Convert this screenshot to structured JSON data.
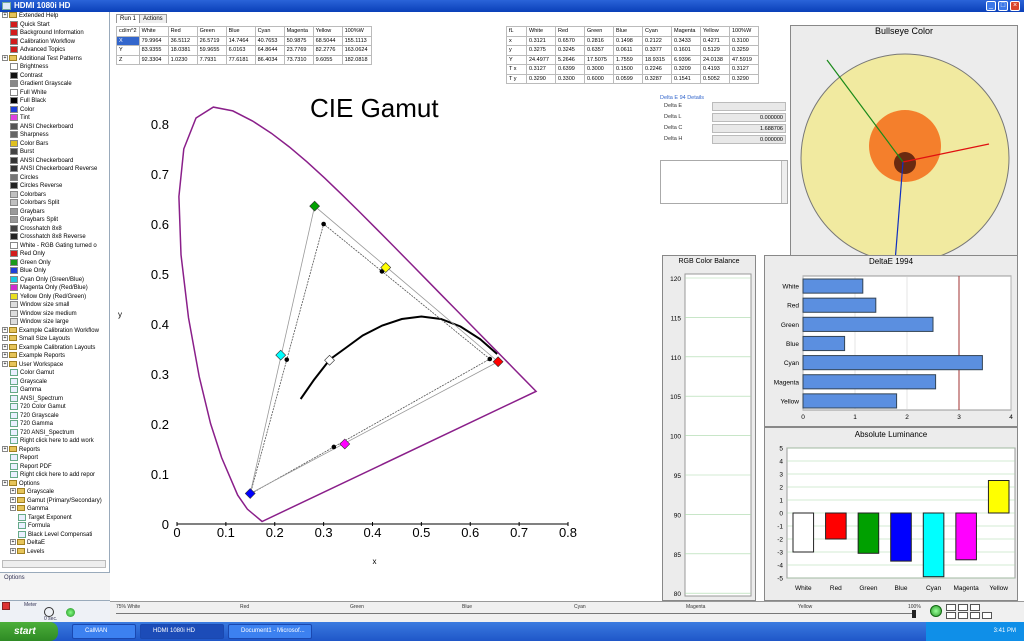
{
  "window": {
    "title": "HDMI 1080i HD",
    "min": "_",
    "max": "□",
    "close": "×"
  },
  "sidebar": {
    "items": [
      {
        "label": "Extended Help",
        "kind": "folder",
        "lvl": 0
      },
      {
        "label": "Quick Start",
        "kind": "swatch",
        "color": "#d21c1c",
        "lvl": 1
      },
      {
        "label": "Background Information",
        "kind": "swatch",
        "color": "#d21c1c",
        "lvl": 1
      },
      {
        "label": "Calibration Workflow",
        "kind": "swatch",
        "color": "#d21c1c",
        "lvl": 1
      },
      {
        "label": "Advanced Topics",
        "kind": "swatch",
        "color": "#d21c1c",
        "lvl": 1
      },
      {
        "label": "Additional Test Patterns",
        "kind": "folder",
        "lvl": 0
      },
      {
        "label": "Brightness",
        "kind": "swatch",
        "color": "#ffffff",
        "lvl": 1
      },
      {
        "label": "Contrast",
        "kind": "swatch",
        "color": "#111111",
        "lvl": 1
      },
      {
        "label": "Gradient Grayscale",
        "kind": "swatch",
        "color": "#888888",
        "lvl": 1
      },
      {
        "label": "Full White",
        "kind": "swatch",
        "color": "#ffffff",
        "lvl": 1
      },
      {
        "label": "Full Black",
        "kind": "swatch",
        "color": "#000000",
        "lvl": 1
      },
      {
        "label": "Color",
        "kind": "swatch",
        "color": "#1e3fd8",
        "lvl": 1
      },
      {
        "label": "Tint",
        "kind": "swatch",
        "color": "#e040e0",
        "lvl": 1
      },
      {
        "label": "ANSI Checkerboard",
        "kind": "swatch",
        "color": "#555555",
        "lvl": 1
      },
      {
        "label": "Sharpness",
        "kind": "swatch",
        "color": "#666666",
        "lvl": 1
      },
      {
        "label": "Color Bars",
        "kind": "swatch",
        "color": "#e0c020",
        "lvl": 1
      },
      {
        "label": "Burst",
        "kind": "swatch",
        "color": "#444444",
        "lvl": 1
      },
      {
        "label": "ANSI Checkerboard",
        "kind": "swatch",
        "color": "#333333",
        "lvl": 1
      },
      {
        "label": "ANSI Checkerboard Reverse",
        "kind": "swatch",
        "color": "#333333",
        "lvl": 1
      },
      {
        "label": "Circles",
        "kind": "swatch",
        "color": "#777777",
        "lvl": 1
      },
      {
        "label": "Circles Reverse",
        "kind": "swatch",
        "color": "#222222",
        "lvl": 1
      },
      {
        "label": "Colorbars",
        "kind": "swatch",
        "color": "#c0c0c0",
        "lvl": 1
      },
      {
        "label": "Colorbars Split",
        "kind": "swatch",
        "color": "#c0c0c0",
        "lvl": 1
      },
      {
        "label": "Graybars",
        "kind": "swatch",
        "color": "#999999",
        "lvl": 1
      },
      {
        "label": "Graybars Split",
        "kind": "swatch",
        "color": "#999999",
        "lvl": 1
      },
      {
        "label": "Crosshatch 8x8",
        "kind": "swatch",
        "color": "#444444",
        "lvl": 1
      },
      {
        "label": "Crosshatch 8x8 Reverse",
        "kind": "swatch",
        "color": "#222222",
        "lvl": 1
      },
      {
        "label": "White - RGB Gating turned o",
        "kind": "swatch",
        "color": "#ffffff",
        "lvl": 1
      },
      {
        "label": "Red Only",
        "kind": "swatch",
        "color": "#d21c1c",
        "lvl": 1
      },
      {
        "label": "Green Only",
        "kind": "swatch",
        "color": "#1a9a1a",
        "lvl": 1
      },
      {
        "label": "Blue Only",
        "kind": "swatch",
        "color": "#1e3fd8",
        "lvl": 1
      },
      {
        "label": "Cyan Only (Green/Blue)",
        "kind": "swatch",
        "color": "#18c8e0",
        "lvl": 1
      },
      {
        "label": "Magenta Only (Red/Blue)",
        "kind": "swatch",
        "color": "#d02ad0",
        "lvl": 1
      },
      {
        "label": "Yellow Only (Red/Green)",
        "kind": "swatch",
        "color": "#e8e020",
        "lvl": 1
      },
      {
        "label": "Window size small",
        "kind": "swatch",
        "color": "#dddddd",
        "lvl": 1
      },
      {
        "label": "Window size medium",
        "kind": "swatch",
        "color": "#dddddd",
        "lvl": 1
      },
      {
        "label": "Window size large",
        "kind": "swatch",
        "color": "#dddddd",
        "lvl": 1
      },
      {
        "label": "Example Calibration Workflow",
        "kind": "folder",
        "lvl": 0
      },
      {
        "label": "Small Size Layouts",
        "kind": "folder",
        "lvl": 0
      },
      {
        "label": "Example Calibration Layouts",
        "kind": "folder",
        "lvl": 0
      },
      {
        "label": "Example Reports",
        "kind": "folder",
        "lvl": 0
      },
      {
        "label": "User Workspace",
        "kind": "folder",
        "lvl": 0
      },
      {
        "label": "Color Gamut",
        "kind": "page",
        "lvl": 1
      },
      {
        "label": "Grayscale",
        "kind": "page",
        "lvl": 1
      },
      {
        "label": "Gamma",
        "kind": "page",
        "lvl": 1
      },
      {
        "label": "ANSI_Spectrum",
        "kind": "page",
        "lvl": 1
      },
      {
        "label": "720 Color Gamut",
        "kind": "page",
        "lvl": 1
      },
      {
        "label": "720 Grayscale",
        "kind": "page",
        "lvl": 1
      },
      {
        "label": "720 Gamma",
        "kind": "page",
        "lvl": 1
      },
      {
        "label": "720 ANSI_Spectrum",
        "kind": "page",
        "lvl": 1
      },
      {
        "label": "Right click here to add work",
        "kind": "page",
        "lvl": 1
      },
      {
        "label": "Reports",
        "kind": "folder",
        "lvl": 0
      },
      {
        "label": "Report",
        "kind": "page",
        "lvl": 1
      },
      {
        "label": "Report PDF",
        "kind": "page",
        "lvl": 1
      },
      {
        "label": "Right click here to add repor",
        "kind": "page",
        "lvl": 1
      },
      {
        "label": "Options",
        "kind": "folder",
        "lvl": 0
      },
      {
        "label": "Grayscale",
        "kind": "folder",
        "lvl": 1
      },
      {
        "label": "Gamut (Primary/Secondary)",
        "kind": "folder",
        "lvl": 1
      },
      {
        "label": "Gamma",
        "kind": "folder",
        "lvl": 1
      },
      {
        "label": "Target Exponent",
        "kind": "page",
        "lvl": 2
      },
      {
        "label": "Formula",
        "kind": "page",
        "lvl": 2
      },
      {
        "label": "Black Level Compensati",
        "kind": "page",
        "lvl": 2
      },
      {
        "label": "DeltaE",
        "kind": "folder",
        "lvl": 1
      },
      {
        "label": "Levels",
        "kind": "folder",
        "lvl": 1
      }
    ],
    "options_label": "Options",
    "meter_label": "Meter",
    "meter_time": "0 sec."
  },
  "tabs": [
    "Run 1",
    "Actions"
  ],
  "table_left": {
    "headers": [
      "cd/m^2",
      "White",
      "Red",
      "Green",
      "Blue",
      "Cyan",
      "Magenta",
      "Yellow",
      "100%W"
    ],
    "rows": [
      [
        "X",
        "79.9964",
        "36.5112",
        "26.5719",
        "14.7464",
        "40.7653",
        "50.9875",
        "68.5044",
        "155.1113"
      ],
      [
        "Y",
        "83.9355",
        "18.0381",
        "59.9655",
        "6.0163",
        "64.8644",
        "23.7769",
        "82.2776",
        "163.0624"
      ],
      [
        "Z",
        "92.3304",
        "1.0230",
        "7.7931",
        "77.6181",
        "86.4034",
        "73.7310",
        "9.6055",
        "182.0818"
      ]
    ]
  },
  "table_right": {
    "headers": [
      "fL",
      "White",
      "Red",
      "Green",
      "Blue",
      "Cyan",
      "Magenta",
      "Yellow",
      "100%W"
    ],
    "rows": [
      [
        "x",
        "0.3121",
        "0.6570",
        "0.2816",
        "0.1498",
        "0.2122",
        "0.3433",
        "0.4271",
        "0.3100"
      ],
      [
        "y",
        "0.3275",
        "0.3245",
        "0.6357",
        "0.0611",
        "0.3377",
        "0.1601",
        "0.5129",
        "0.3259"
      ],
      [
        "Y",
        "24.4977",
        "5.2646",
        "17.5075",
        "1.7559",
        "18.9315",
        "6.9396",
        "24.0138",
        "47.5919"
      ],
      [
        "T x",
        "0.3127",
        "0.6399",
        "0.3000",
        "0.1500",
        "0.2246",
        "0.3209",
        "0.4193",
        "0.3127"
      ],
      [
        "T y",
        "0.3290",
        "0.3300",
        "0.6000",
        "0.0599",
        "0.3287",
        "0.1541",
        "0.5052",
        "0.3290"
      ]
    ]
  },
  "delta_details": {
    "title": "Delta E 94 Details",
    "labels": [
      "Delta E",
      "Delta L",
      "Delta C",
      "Delta H"
    ],
    "values": [
      "",
      "0.000000",
      "1.688706",
      "0.000000"
    ]
  },
  "bottom_labels": [
    "75% White",
    "Red",
    "Green",
    "Blue",
    "Cyan",
    "Magenta",
    "Yellow",
    "100%"
  ],
  "taskbar": {
    "start": "start",
    "tasks": [
      "CalMAN",
      "HDMI 1080i HD",
      "Document1 - Microsof..."
    ],
    "clock": "3:41 PM"
  },
  "colors": {
    "white": "#ffffff",
    "red": "#ff0000",
    "green": "#00a000",
    "blue": "#0000ff",
    "cyan": "#00ffff",
    "magenta": "#ff00ff",
    "yellow": "#ffff00",
    "barblue": "#5b8fe0",
    "locus": "#8a1f8a"
  },
  "chart_data": [
    {
      "type": "scatter",
      "title": "CIE Gamut",
      "xlabel": "x",
      "ylabel": "y",
      "xlim": [
        0,
        0.8
      ],
      "ylim": [
        0,
        0.85
      ],
      "xticks": [
        "0",
        "0.1",
        "0.2",
        "0.3",
        "0.4",
        "0.5",
        "0.6",
        "0.7",
        "0.8"
      ],
      "yticks": [
        "0",
        "0.1",
        "0.2",
        "0.3",
        "0.4",
        "0.5",
        "0.6",
        "0.7",
        "0.8"
      ],
      "measured": {
        "red": [
          0.657,
          0.3245
        ],
        "green": [
          0.2816,
          0.6357
        ],
        "blue": [
          0.1498,
          0.0611
        ],
        "cyan": [
          0.2122,
          0.3377
        ],
        "magenta": [
          0.3433,
          0.1601
        ],
        "yellow": [
          0.4271,
          0.5129
        ],
        "white": [
          0.3121,
          0.3275
        ]
      },
      "target": {
        "red": [
          0.64,
          0.33
        ],
        "green": [
          0.3,
          0.6
        ],
        "blue": [
          0.15,
          0.06
        ],
        "cyan": [
          0.2246,
          0.3287
        ],
        "magenta": [
          0.3209,
          0.1541
        ],
        "yellow": [
          0.4193,
          0.5052
        ],
        "white": [
          0.3127,
          0.329
        ]
      }
    },
    {
      "type": "bar",
      "title": "DeltaE 1994",
      "orientation": "horizontal",
      "categories": [
        "White",
        "Red",
        "Green",
        "Blue",
        "Cyan",
        "Magenta",
        "Yellow"
      ],
      "values": [
        1.15,
        1.4,
        2.5,
        0.8,
        3.45,
        2.55,
        1.8
      ],
      "xlim": [
        0,
        4
      ],
      "xticks": [
        "0",
        "1",
        "2",
        "3",
        "4"
      ],
      "threshold": 3
    },
    {
      "type": "bar",
      "title": "Absolute Luminance",
      "categories": [
        "White",
        "Red",
        "Green",
        "Blue",
        "Cyan",
        "Magenta",
        "Yellow"
      ],
      "values": [
        -3.0,
        -2.0,
        -3.1,
        -3.7,
        -4.9,
        -3.6,
        2.5
      ],
      "ylim": [
        -5,
        5
      ],
      "yticks": [
        "5",
        "4",
        "3",
        "2",
        "1",
        "0",
        "-1",
        "-2",
        "-3",
        "-4",
        "-5"
      ]
    },
    {
      "type": "bar",
      "title": "RGB Color Balance",
      "categories": [],
      "values": [],
      "ylim": [
        80,
        120
      ],
      "yticks": [
        "120",
        "115",
        "110",
        "105",
        "100",
        "95",
        "90",
        "85",
        "80"
      ]
    },
    {
      "type": "scatter",
      "title": "Bullseye Color",
      "values": []
    }
  ]
}
